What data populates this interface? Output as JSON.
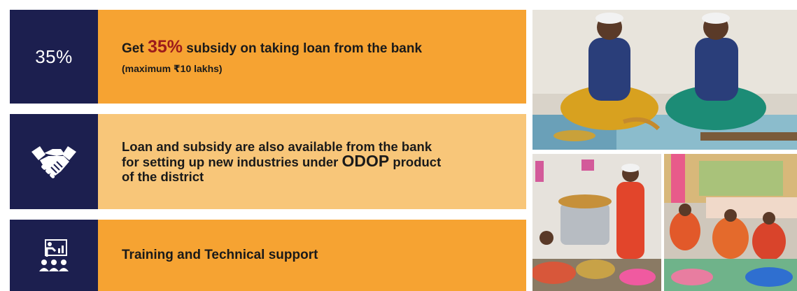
{
  "rows": [
    {
      "badge": "35%",
      "text_before": "Get ",
      "highlight": "35%",
      "text_after": " subsidy on taking loan from the bank",
      "subtext": "(maximum ₹10 lakhs)"
    },
    {
      "badge_icon": "handshake-icon",
      "line_a": "Loan and subsidy are also available from the bank",
      "line_b_before": "for setting up new industries under ",
      "line_b_highlight": "ODOP",
      "line_b_after": " product",
      "line_c": "of the district"
    },
    {
      "badge_icon": "training-presentation-icon",
      "text": "Training and Technical support"
    }
  ],
  "colors": {
    "navy": "#1c1f4f",
    "orange": "#f6a332",
    "light_orange": "#f8c679",
    "accent_red": "#9c1b1b"
  },
  "photos": [
    {
      "icon": "photo-women-processing-food"
    },
    {
      "icon": "photo-woman-at-machine"
    },
    {
      "icon": "photo-women-packaging"
    }
  ]
}
